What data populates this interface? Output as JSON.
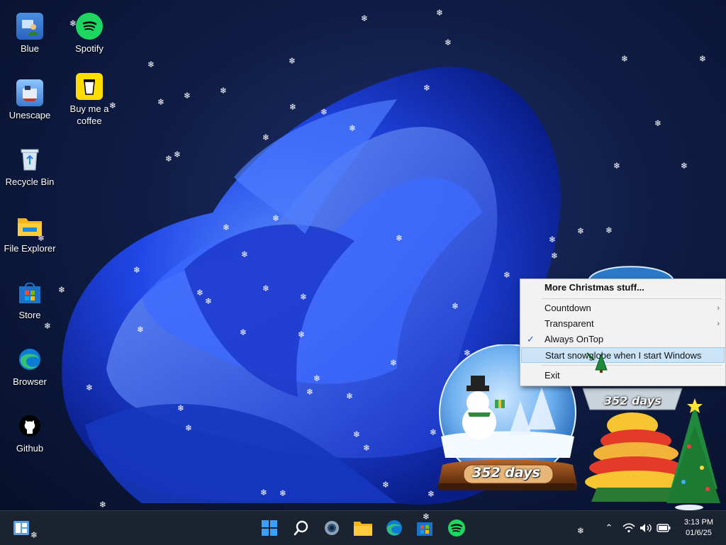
{
  "desktop_icons": [
    {
      "label": "Blue",
      "icon": "blue-user-icon"
    },
    {
      "label": "Spotify",
      "icon": "spotify-icon"
    },
    {
      "label": "Unescape",
      "icon": "unescape-icon"
    },
    {
      "label": "Buy me a coffee",
      "icon": "coffee-cup-icon"
    },
    {
      "label": "Recycle Bin",
      "icon": "recycle-bin-icon"
    },
    {
      "label": "File Explorer",
      "icon": "folder-icon"
    },
    {
      "label": "Store",
      "icon": "store-icon"
    },
    {
      "label": "Browser",
      "icon": "edge-browser-icon"
    },
    {
      "label": "Github",
      "icon": "github-icon"
    }
  ],
  "context_menu": {
    "header": "More Christmas stuff...",
    "items": [
      {
        "label": "Countdown",
        "submenu": true,
        "checked": false
      },
      {
        "label": "Transparent",
        "submenu": true,
        "checked": false
      },
      {
        "label": "Always OnTop",
        "submenu": false,
        "checked": true
      },
      {
        "label": "Start snowglobe when I start Windows",
        "submenu": false,
        "checked": false,
        "highlighted": true
      }
    ],
    "exit": "Exit"
  },
  "widgets": {
    "snowglobe_countdown": "352 days",
    "tree_countdown": "352 days"
  },
  "taskbar": {
    "apps": [
      "start-icon",
      "search-icon",
      "settings-icon",
      "file-explorer-icon",
      "edge-icon",
      "store-icon",
      "spotify-icon"
    ],
    "tray": [
      "chevron-up-icon",
      "wifi-icon",
      "volume-icon",
      "battery-icon"
    ],
    "time": "3:13 PM",
    "date": "01/6/25"
  },
  "colors": {
    "menu_highlight": "#cce4f7",
    "taskbar": "#1b2331",
    "accent": "#2d5bff"
  }
}
